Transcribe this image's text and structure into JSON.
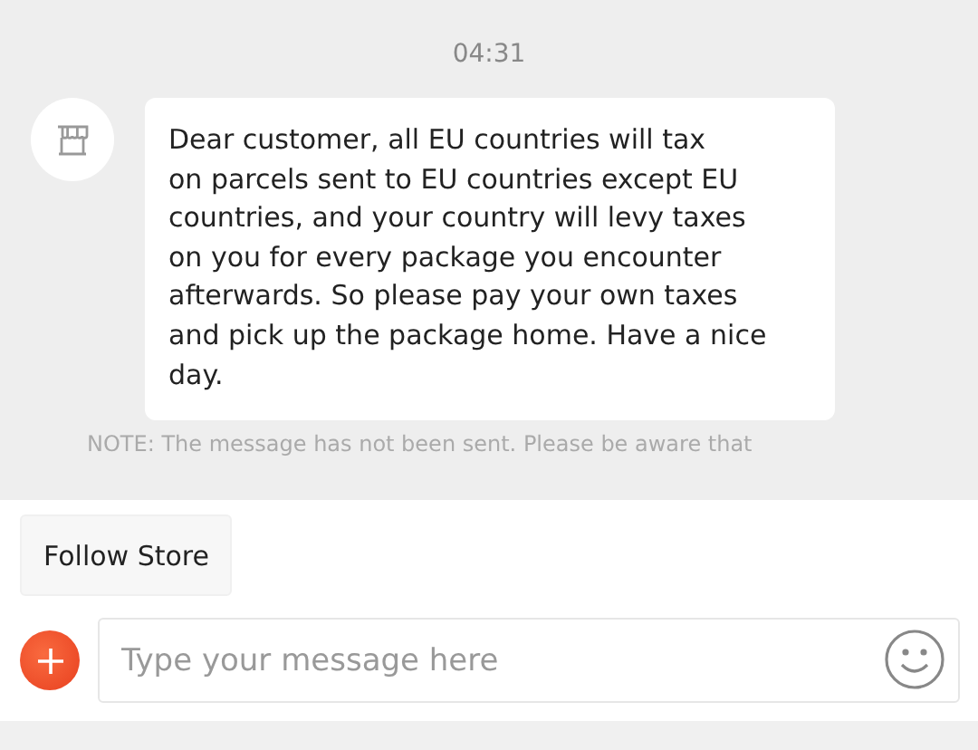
{
  "timestamp": "04:31",
  "message": {
    "lines": [
      "Dear customer, all EU countries will tax",
      "on parcels sent to EU countries except EU",
      "countries, and your country will levy taxes",
      "on you for every package you encounter",
      "afterwards. So please pay your own taxes",
      "and pick up the package home. Have a nice",
      "day."
    ]
  },
  "note": "NOTE: The message has not been sent. Please be aware that",
  "follow_button": "Follow Store",
  "composer": {
    "placeholder": "Type your message here"
  }
}
